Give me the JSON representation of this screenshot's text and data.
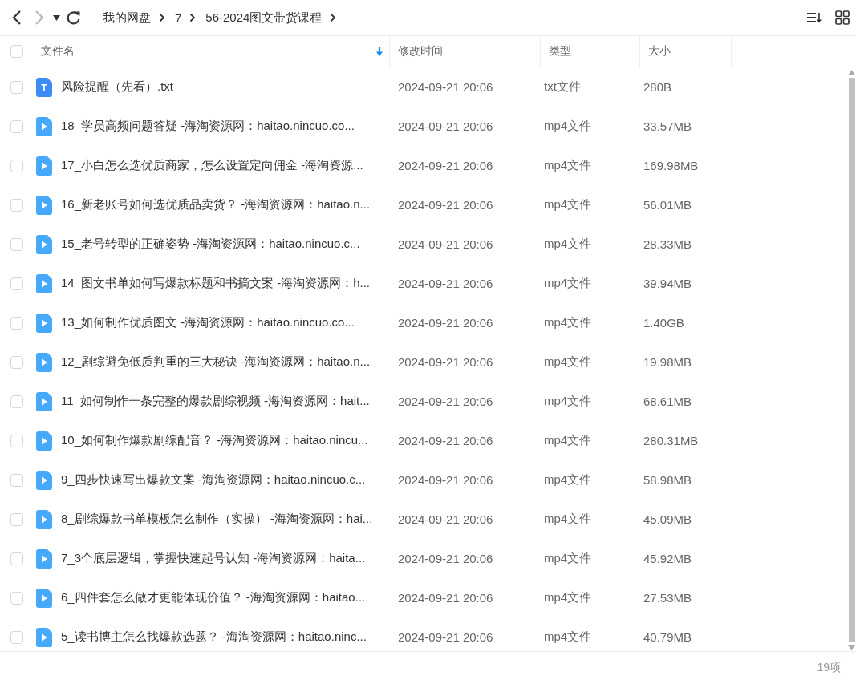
{
  "toolbar": {
    "nav": [
      {
        "kind": "back",
        "disabled": false
      },
      {
        "kind": "forward",
        "disabled": true
      },
      {
        "kind": "history",
        "disabled": false
      },
      {
        "kind": "refresh",
        "disabled": false
      }
    ],
    "breadcrumbs": [
      "我的网盘",
      "7",
      "56-2024图文带货课程"
    ]
  },
  "table": {
    "select_all": {
      "checked": false
    },
    "columns": [
      {
        "label": "文件名",
        "sorted": true
      },
      {
        "label": "修改时间",
        "sorted": false
      },
      {
        "label": "类型",
        "sorted": false
      },
      {
        "label": "大小",
        "sorted": false
      }
    ],
    "rows": [
      {
        "kind": "txt",
        "icon_text": "T",
        "checked": false,
        "name": "风险提醒（先看）.txt",
        "modified": "2024-09-21 20:06",
        "type": "txt文件",
        "size": "280B"
      },
      {
        "kind": "mp4",
        "checked": false,
        "name": "18_学员高频问题答疑 -海淘资源网：haitao.nincuo.co...",
        "modified": "2024-09-21 20:06",
        "type": "mp4文件",
        "size": "33.57MB"
      },
      {
        "kind": "mp4",
        "checked": false,
        "name": "17_小白怎么选优质商家，怎么设置定向佣金 -海淘资源...",
        "modified": "2024-09-21 20:06",
        "type": "mp4文件",
        "size": "169.98MB"
      },
      {
        "kind": "mp4",
        "checked": false,
        "name": "16_新老账号如何选优质品卖货？ -海淘资源网：haitao.n...",
        "modified": "2024-09-21 20:06",
        "type": "mp4文件",
        "size": "56.01MB"
      },
      {
        "kind": "mp4",
        "checked": false,
        "name": "15_老号转型的正确姿势 -海淘资源网：haitao.nincuo.c...",
        "modified": "2024-09-21 20:06",
        "type": "mp4文件",
        "size": "28.33MB"
      },
      {
        "kind": "mp4",
        "checked": false,
        "name": "14_图文书单如何写爆款标题和书摘文案 -海淘资源网：h...",
        "modified": "2024-09-21 20:06",
        "type": "mp4文件",
        "size": "39.94MB"
      },
      {
        "kind": "mp4",
        "checked": false,
        "name": "13_如何制作优质图文 -海淘资源网：haitao.nincuo.co...",
        "modified": "2024-09-21 20:06",
        "type": "mp4文件",
        "size": "1.40GB"
      },
      {
        "kind": "mp4",
        "checked": false,
        "name": "12_剧综避免低质判重的三大秘诀 -海淘资源网：haitao.n...",
        "modified": "2024-09-21 20:06",
        "type": "mp4文件",
        "size": "19.98MB"
      },
      {
        "kind": "mp4",
        "checked": false,
        "name": "11_如何制作一条完整的爆款剧综视频 -海淘资源网：hait...",
        "modified": "2024-09-21 20:06",
        "type": "mp4文件",
        "size": "68.61MB"
      },
      {
        "kind": "mp4",
        "checked": false,
        "name": "10_如何制作爆款剧综配音？ -海淘资源网：haitao.nincu...",
        "modified": "2024-09-21 20:06",
        "type": "mp4文件",
        "size": "280.31MB"
      },
      {
        "kind": "mp4",
        "checked": false,
        "name": "9_四步快速写出爆款文案 -海淘资源网：haitao.nincuo.c...",
        "modified": "2024-09-21 20:06",
        "type": "mp4文件",
        "size": "58.98MB"
      },
      {
        "kind": "mp4",
        "checked": false,
        "name": "8_剧综爆款书单模板怎么制作（实操） -海淘资源网：hai...",
        "modified": "2024-09-21 20:06",
        "type": "mp4文件",
        "size": "45.09MB"
      },
      {
        "kind": "mp4",
        "checked": false,
        "name": "7_3个底层逻辑，掌握快速起号认知 -海淘资源网：haita...",
        "modified": "2024-09-21 20:06",
        "type": "mp4文件",
        "size": "45.92MB"
      },
      {
        "kind": "mp4",
        "checked": false,
        "name": "6_四件套怎么做才更能体现价值？ -海淘资源网：haitao....",
        "modified": "2024-09-21 20:06",
        "type": "mp4文件",
        "size": "27.53MB"
      },
      {
        "kind": "mp4",
        "checked": false,
        "name": "5_读书博主怎么找爆款选题？ -海淘资源网：haitao.ninc...",
        "modified": "2024-09-21 20:06",
        "type": "mp4文件",
        "size": "40.79MB"
      }
    ]
  },
  "status_bar": {
    "count": "19项"
  }
}
